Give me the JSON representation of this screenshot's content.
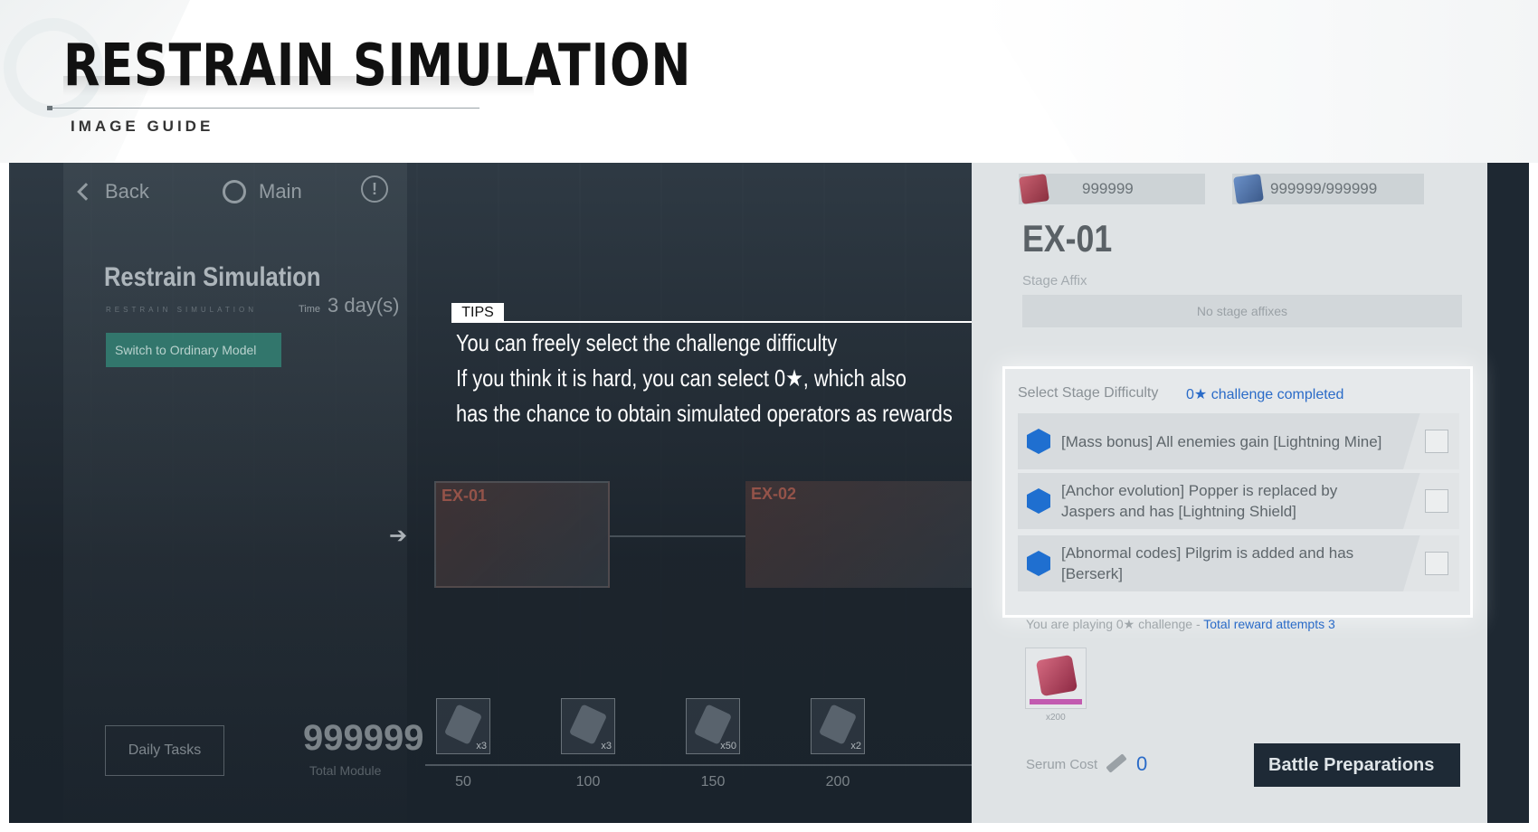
{
  "header": {
    "title": "RESTRAIN SIMULATION",
    "subtitle": "IMAGE GUIDE"
  },
  "game": {
    "nav": {
      "back": "Back",
      "main": "Main",
      "info": "!"
    },
    "mode": {
      "title": "Restrain Simulation",
      "subtitle": "RESTRAIN SIMULATION",
      "time_label": "Time",
      "time_value": "3 day(s)",
      "switch_button": "Switch to Ordinary Model"
    },
    "stages": [
      {
        "label": "EX-01"
      },
      {
        "label": "EX-02"
      }
    ],
    "daily_tasks": "Daily Tasks",
    "module": {
      "value": "999999",
      "label": "Total Module"
    },
    "rewards": [
      {
        "qty": "x3",
        "milestone": "50"
      },
      {
        "qty": "x3",
        "milestone": "100"
      },
      {
        "qty": "x50",
        "milestone": "150"
      },
      {
        "qty": "x2",
        "milestone": "200"
      }
    ]
  },
  "tips": {
    "label": "TIPS",
    "lines": [
      "You can freely select the challenge difficulty",
      "If you think it is hard, you can select 0★, which also",
      "has the chance to obtain simulated operators as rewards"
    ]
  },
  "panel": {
    "currency_a": "999999",
    "currency_b": "999999/999999",
    "stage_name": "EX-01",
    "affix_label": "Stage Affix",
    "affix_value": "No stage affixes",
    "difficulty": {
      "heading": "Select Stage Difficulty",
      "status": "0★ challenge completed",
      "options": [
        {
          "text": "[Mass bonus] All enemies gain [Lightning Mine]",
          "checked": false
        },
        {
          "text": "[Anchor evolution] Popper is replaced by Jaspers and has [Lightning Shield]",
          "checked": false
        },
        {
          "text": "[Abnormal codes] Pilgrim is added and has [Berserk]",
          "checked": false
        }
      ]
    },
    "playing_prefix": "You are playing 0★ challenge - ",
    "playing_attempts": "Total reward attempts 3",
    "reward_qty": "x200",
    "serum_label": "Serum Cost",
    "serum_value": "0",
    "battle_button": "Battle Preparations"
  },
  "colors": {
    "accent_blue": "#2a6bc8",
    "hex_blue": "#1f6fd0",
    "switch_green": "#34968a",
    "button_dark": "#1e2a36"
  }
}
